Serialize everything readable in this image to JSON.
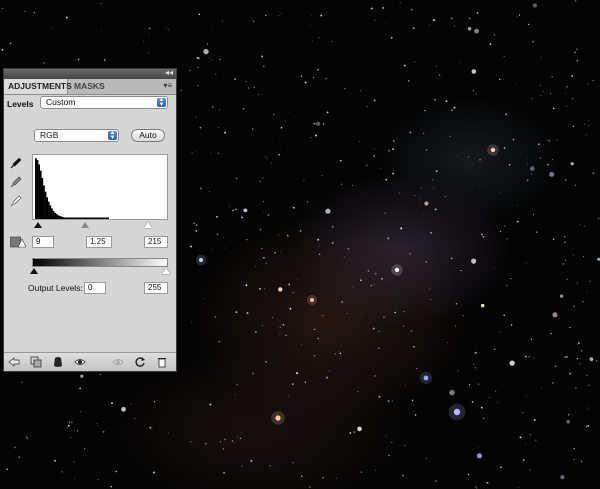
{
  "panel": {
    "tabs": [
      "ADJUSTMENTS",
      "MASKS"
    ],
    "collapse_glyph": "◂◂",
    "menu_glyph": "▾≡",
    "title_label": "Levels",
    "preset_value": "Custom",
    "channel_value": "RGB",
    "auto_label": "Auto",
    "input_levels": {
      "black": "9",
      "gamma": "1.25",
      "white": "215"
    },
    "output_label": "Output Levels:",
    "output_levels": {
      "black": "0",
      "white": "255"
    }
  },
  "histogram_data": {
    "levels_0_to_100": [
      98,
      95,
      88,
      78,
      66,
      54,
      44,
      35,
      28,
      22,
      17,
      13,
      10,
      8,
      6,
      5,
      4,
      3,
      2.5,
      2,
      1.5,
      1.2,
      1,
      0.8,
      0.6,
      0.5,
      0.4,
      0.3,
      0.2,
      0.2,
      0.1
    ]
  },
  "icons": {
    "eyedroppers": [
      "black-point-eyedropper-icon",
      "gray-point-eyedropper-icon",
      "white-point-eyedropper-icon"
    ],
    "clipping": "clipping-warning-icon",
    "bottom": [
      "back-arrow-icon",
      "clip-to-layer-icon",
      "mask-icon",
      "visibility-eye-icon",
      "view-previous-icon",
      "reset-icon",
      "trash-icon"
    ]
  },
  "colors": {
    "panel_bg": "#d6d6d6",
    "select_accent": "#2a5dc0",
    "canvas_bg": "#040404"
  }
}
